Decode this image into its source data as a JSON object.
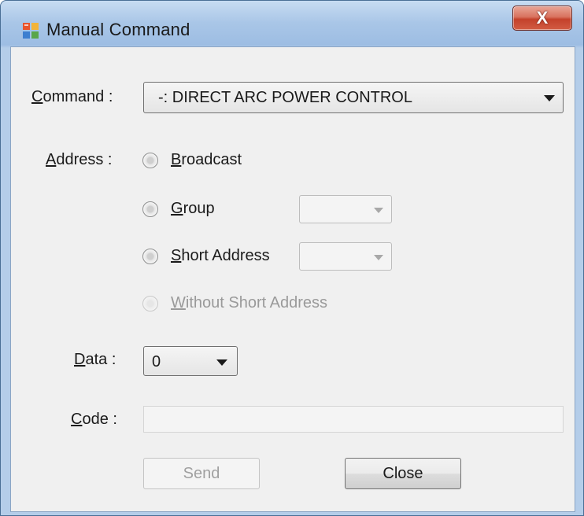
{
  "window": {
    "title": "Manual Command",
    "close_glyph": "X",
    "icon": "app-window-icon"
  },
  "command": {
    "label_accel": "C",
    "label_rest": "ommand :",
    "selected": "-: DIRECT ARC POWER CONTROL"
  },
  "address": {
    "label_accel": "A",
    "label_rest": "ddress :",
    "options": [
      {
        "accel": "B",
        "rest": "roadcast",
        "enabled": true,
        "checked": false
      },
      {
        "accel": "G",
        "rest": "roup",
        "enabled": true,
        "checked": false
      },
      {
        "accel": "S",
        "rest": "hort Address",
        "enabled": true,
        "checked": false
      },
      {
        "accel": "W",
        "rest": "ithout Short Address",
        "enabled": false,
        "checked": false
      }
    ],
    "group_value": "",
    "short_address_value": ""
  },
  "data_field": {
    "label_accel": "D",
    "label_rest": "ata :",
    "selected": "0"
  },
  "code_field": {
    "label_accel": "C",
    "label_rest": "ode :",
    "value": ""
  },
  "buttons": {
    "send": "Send",
    "close": "Close"
  },
  "colors": {
    "titlebar": "#a9c6e7",
    "client_bg": "#f0f0f0",
    "close_button": "#c4412b",
    "disabled_text": "#9a9a9a"
  }
}
